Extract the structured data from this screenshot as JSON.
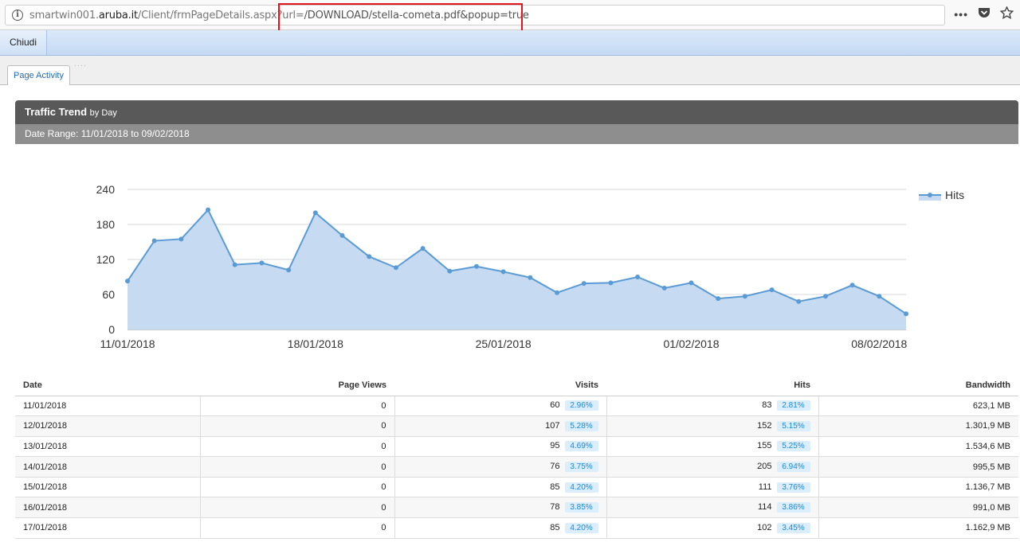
{
  "browser": {
    "url_host_prefix": "smartwin001.",
    "url_host_domain": "aruba.it",
    "url_path": "/Client/frmPageDetails.aspx?url=",
    "url_highlighted": "/DOWNLOAD/stella-cometa.pdf&popup=true",
    "menu_dots": "•••"
  },
  "toolbar": {
    "close_label": "Chiudi"
  },
  "tabs": [
    {
      "label": "Page Activity"
    }
  ],
  "panel": {
    "title": "Traffic Trend",
    "title_suffix": "by Day",
    "date_range": "Date Range: 11/01/2018 to 09/02/2018"
  },
  "chart_data": {
    "type": "area",
    "legend": {
      "position": "top-right",
      "entries": [
        "Hits"
      ]
    },
    "series": [
      {
        "name": "Hits",
        "color": "#5b9bd5",
        "values": [
          83,
          152,
          155,
          205,
          111,
          114,
          102,
          200,
          161,
          125,
          106,
          139,
          100,
          108,
          99,
          89,
          63,
          79,
          80,
          90,
          71,
          80,
          53,
          57,
          68,
          48,
          57,
          76,
          57,
          27
        ]
      }
    ],
    "x": [
      "11/01/2018",
      "12/01/2018",
      "13/01/2018",
      "14/01/2018",
      "15/01/2018",
      "16/01/2018",
      "17/01/2018",
      "18/01/2018",
      "19/01/2018",
      "20/01/2018",
      "21/01/2018",
      "22/01/2018",
      "23/01/2018",
      "24/01/2018",
      "25/01/2018",
      "26/01/2018",
      "27/01/2018",
      "28/01/2018",
      "29/01/2018",
      "30/01/2018",
      "31/01/2018",
      "01/02/2018",
      "02/02/2018",
      "03/02/2018",
      "04/02/2018",
      "05/02/2018",
      "06/02/2018",
      "07/02/2018",
      "08/02/2018",
      "09/02/2018"
    ],
    "x_tick_labels": [
      "11/01/2018",
      "18/01/2018",
      "25/01/2018",
      "01/02/2018",
      "08/02/2018"
    ],
    "y_ticks": [
      0,
      60,
      120,
      180,
      240
    ],
    "ylim": [
      0,
      240
    ],
    "grid": true
  },
  "table": {
    "headers": [
      "Date",
      "Page Views",
      "Visits",
      "Hits",
      "Bandwidth"
    ],
    "rows": [
      {
        "date": "11/01/2018",
        "page_views": "0",
        "visits": "60",
        "visits_pct": "2.96%",
        "hits": "83",
        "hits_pct": "2.81%",
        "bandwidth": "623,1 MB"
      },
      {
        "date": "12/01/2018",
        "page_views": "0",
        "visits": "107",
        "visits_pct": "5.28%",
        "hits": "152",
        "hits_pct": "5.15%",
        "bandwidth": "1.301,9 MB"
      },
      {
        "date": "13/01/2018",
        "page_views": "0",
        "visits": "95",
        "visits_pct": "4.69%",
        "hits": "155",
        "hits_pct": "5.25%",
        "bandwidth": "1.534,6 MB"
      },
      {
        "date": "14/01/2018",
        "page_views": "0",
        "visits": "76",
        "visits_pct": "3.75%",
        "hits": "205",
        "hits_pct": "6.94%",
        "bandwidth": "995,5 MB"
      },
      {
        "date": "15/01/2018",
        "page_views": "0",
        "visits": "85",
        "visits_pct": "4.20%",
        "hits": "111",
        "hits_pct": "3.76%",
        "bandwidth": "1.136,7 MB"
      },
      {
        "date": "16/01/2018",
        "page_views": "0",
        "visits": "78",
        "visits_pct": "3.85%",
        "hits": "114",
        "hits_pct": "3.86%",
        "bandwidth": "991,0 MB"
      },
      {
        "date": "17/01/2018",
        "page_views": "0",
        "visits": "85",
        "visits_pct": "4.20%",
        "hits": "102",
        "hits_pct": "3.45%",
        "bandwidth": "1.162,9 MB"
      }
    ]
  }
}
